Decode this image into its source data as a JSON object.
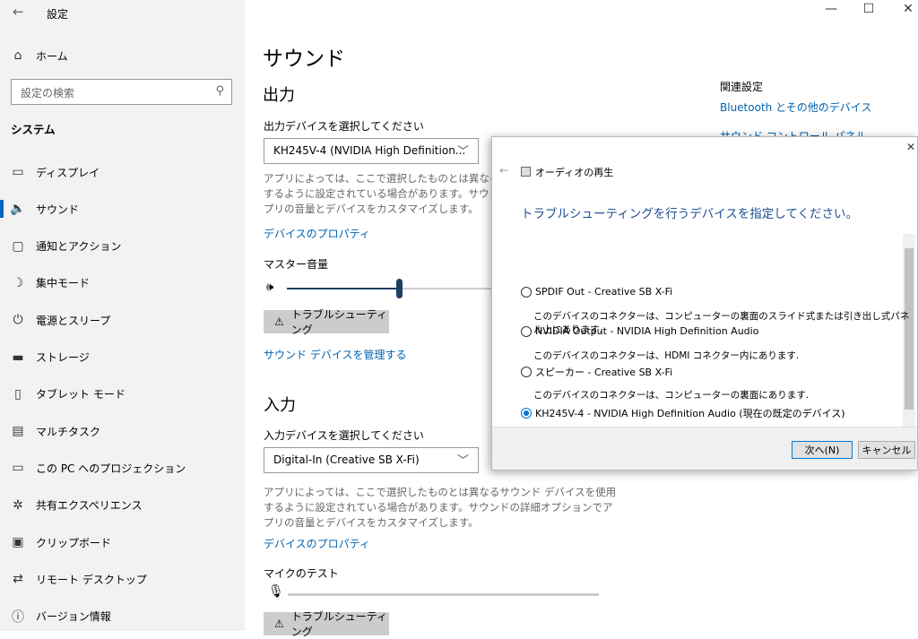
{
  "window": {
    "title": "設定",
    "back": "←",
    "minimize": "—",
    "maximize": "☐",
    "close": "✕"
  },
  "sidebar": {
    "home": "ホーム",
    "search_placeholder": "設定の検索",
    "section": "システム",
    "items": [
      {
        "icon": "▭",
        "label": "ディスプレイ"
      },
      {
        "icon": "🔈",
        "label": "サウンド"
      },
      {
        "icon": "▢",
        "label": "通知とアクション"
      },
      {
        "icon": "☽",
        "label": "集中モード"
      },
      {
        "icon": "⏻",
        "label": "電源とスリープ"
      },
      {
        "icon": "▬",
        "label": "ストレージ"
      },
      {
        "icon": "▯",
        "label": "タブレット モード"
      },
      {
        "icon": "▤",
        "label": "マルチタスク"
      },
      {
        "icon": "▭",
        "label": "この PC へのプロジェクション"
      },
      {
        "icon": "✲",
        "label": "共有エクスペリエンス"
      },
      {
        "icon": "▣",
        "label": "クリップボード"
      },
      {
        "icon": "⇄",
        "label": "リモート デスクトップ"
      },
      {
        "icon": "ⓘ",
        "label": "バージョン情報"
      }
    ],
    "selected_index": 1
  },
  "main": {
    "title": "サウンド",
    "output": {
      "heading": "出力",
      "select_label": "出力デバイスを選択してください",
      "selected": "KH245V-4 (NVIDIA High Definition...",
      "desc": "アプリによっては、ここで選択したものとは異なるサウンド デバイスを使用するように設定されている場合があります。サウンドの詳細オプションでアプリの音量とデバイスをカスタマイズします。",
      "properties_link": "デバイスのプロパティ",
      "volume_label": "マスター音量",
      "volume_percent": 40,
      "troubleshoot": "トラブルシューティング",
      "manage_link": "サウンド デバイスを管理する"
    },
    "input": {
      "heading": "入力",
      "select_label": "入力デバイスを選択してください",
      "selected": "Digital-In (Creative SB X-Fi)",
      "desc": "アプリによっては、ここで選択したものとは異なるサウンド デバイスを使用するように設定されている場合があります。サウンドの詳細オプションでアプリの音量とデバイスをカスタマイズします。",
      "properties_link": "デバイスのプロパティ",
      "mic_test_label": "マイクのテスト",
      "mic_level_percent": 0,
      "troubleshoot": "トラブルシューティング"
    }
  },
  "related": {
    "heading": "関連設定",
    "links": [
      "Bluetooth とその他のデバイス",
      "サウンド コントロール パネル"
    ]
  },
  "dialog": {
    "title": "オーディオの再生",
    "heading": "トラブルシューティングを行うデバイスを指定してください。",
    "options": [
      {
        "label": "SPDIF Out - Creative SB X-Fi",
        "desc": "このデバイスのコネクターは、コンピューターの裏面のスライド式または引き出し式パネル上にあります.",
        "checked": false
      },
      {
        "label": "NVIDIA Output - NVIDIA High Definition Audio",
        "desc": "このデバイスのコネクターは、HDMI コネクター内にあります.",
        "checked": false
      },
      {
        "label": "スピーカー - Creative SB X-Fi",
        "desc": "このデバイスのコネクターは、コンピューターの裏面にあります.",
        "checked": false
      },
      {
        "label": "KH245V-4 - NVIDIA High Definition Audio (現在の既定のデバイス)",
        "checked": true
      }
    ],
    "next": "次へ(N)",
    "cancel": "キャンセル",
    "close": "✕"
  },
  "colors": {
    "accent": "#0067c0",
    "link": "#0063b1",
    "dialog_heading": "#1e4f91"
  }
}
